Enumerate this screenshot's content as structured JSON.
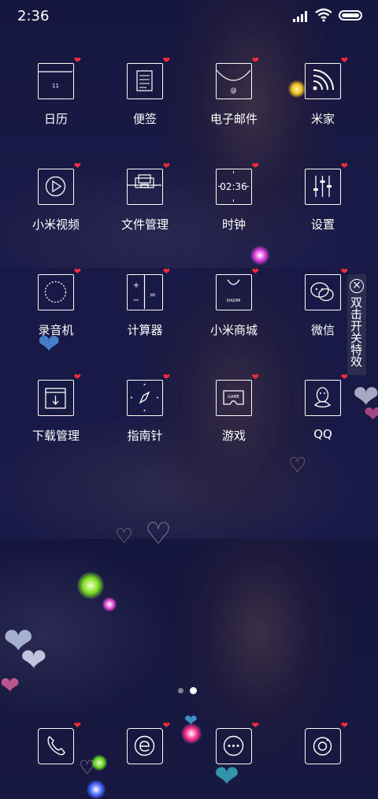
{
  "status_bar": {
    "time": "2:36"
  },
  "apps": [
    {
      "label": "日历",
      "icon": "calendar-icon",
      "badge": "11"
    },
    {
      "label": "便签",
      "icon": "notes-icon"
    },
    {
      "label": "电子邮件",
      "icon": "email-icon",
      "badge": "@"
    },
    {
      "label": "米家",
      "icon": "mijia-icon"
    },
    {
      "label": "小米视频",
      "icon": "video-play-icon"
    },
    {
      "label": "文件管理",
      "icon": "folder-icon"
    },
    {
      "label": "时钟",
      "icon": "clock-icon",
      "badge": "02:36"
    },
    {
      "label": "设置",
      "icon": "settings-sliders-icon"
    },
    {
      "label": "录音机",
      "icon": "recorder-icon"
    },
    {
      "label": "计算器",
      "icon": "calculator-icon"
    },
    {
      "label": "小米商城",
      "icon": "mi-store-bag-icon",
      "badge": "XIAOMI"
    },
    {
      "label": "微信",
      "icon": "wechat-icon"
    },
    {
      "label": "下载管理",
      "icon": "download-icon"
    },
    {
      "label": "指南针",
      "icon": "compass-icon"
    },
    {
      "label": "游戏",
      "icon": "game-controller-icon",
      "badge": "GAME"
    },
    {
      "label": "QQ",
      "icon": "qq-penguin-icon"
    }
  ],
  "dock": [
    {
      "icon": "phone-icon"
    },
    {
      "icon": "browser-icon"
    },
    {
      "icon": "messages-icon"
    },
    {
      "icon": "camera-icon"
    }
  ],
  "page_indicator": {
    "pages": 2,
    "active": 2
  },
  "effect_toggle": {
    "label": "双击开关特效"
  },
  "colors": {
    "background": "#12123f",
    "heart_badge": "#ff2a3a",
    "icon_line": "#ffffff"
  }
}
